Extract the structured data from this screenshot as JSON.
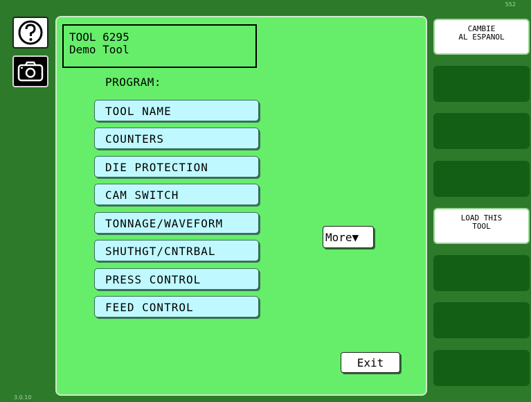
{
  "corner_top_right": "552",
  "version": "3.0.10",
  "left_icons": {
    "help": "question-mark-icon",
    "camera": "camera-icon"
  },
  "tool": {
    "line1": "TOOL 6295",
    "line2": "Demo Tool"
  },
  "program_label": "PROGRAM:",
  "program_buttons": [
    "TOOL NAME",
    "COUNTERS",
    "DIE PROTECTION",
    "CAM SWITCH",
    "TONNAGE/WAVEFORM",
    "SHUTHGT/CNTRBAL",
    "PRESS CONTROL",
    "FEED CONTROL"
  ],
  "more_label": "More▼",
  "exit_label": "Exit",
  "side_buttons": [
    {
      "line1": "CAMBIE",
      "line2": "AL ESPANOL"
    },
    {
      "line1": "",
      "line2": ""
    },
    {
      "line1": "",
      "line2": ""
    },
    {
      "line1": "",
      "line2": ""
    },
    {
      "line1": "LOAD THIS",
      "line2": "TOOL"
    },
    {
      "line1": "",
      "line2": ""
    },
    {
      "line1": "",
      "line2": ""
    },
    {
      "line1": "",
      "line2": ""
    }
  ],
  "colors": {
    "background": "#2c7a2a",
    "panel": "#66ee6a",
    "program_button": "#bff9ff",
    "side_button_empty": "#145f16"
  }
}
